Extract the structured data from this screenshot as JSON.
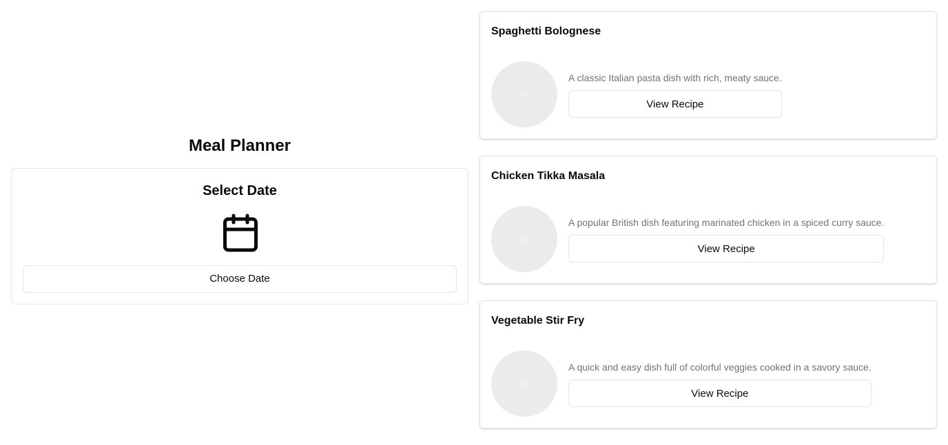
{
  "page": {
    "title": "Meal Planner"
  },
  "date_picker": {
    "title": "Select Date",
    "icon": "calendar-icon",
    "button_label": "Choose Date"
  },
  "recipes": [
    {
      "name": "Spaghetti Bolognese",
      "description": "A classic Italian pasta dish with rich, meaty sauce.",
      "button_label": "View Recipe",
      "image": "image-placeholder-icon"
    },
    {
      "name": "Chicken Tikka Masala",
      "description": "A popular British dish featuring marinated chicken in a spiced curry sauce.",
      "button_label": "View Recipe",
      "image": "image-placeholder-icon"
    },
    {
      "name": "Vegetable Stir Fry",
      "description": "A quick and easy dish full of colorful veggies cooked in a savory sauce.",
      "button_label": "View Recipe",
      "image": "image-placeholder-icon"
    }
  ],
  "colors": {
    "text": "#0a0a0a",
    "muted_text": "#737373",
    "border": "#e5e5e5",
    "placeholder": "#ebebeb"
  }
}
